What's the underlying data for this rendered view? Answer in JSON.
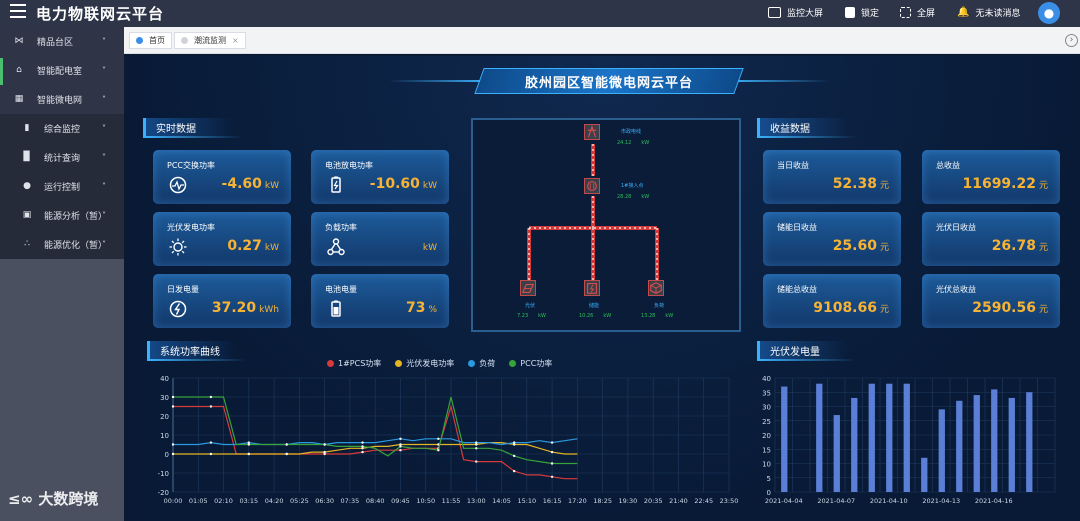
{
  "app": {
    "title": "电力物联网云平台",
    "menu_icon": "hamburger-icon"
  },
  "topbar": {
    "items": [
      {
        "label": "监控大屏",
        "icon": "monitor-icon"
      },
      {
        "label": "锁定",
        "icon": "lock-icon"
      },
      {
        "label": "全屏",
        "icon": "fullscreen-icon"
      },
      {
        "label": "无未读消息",
        "icon": "bell-icon"
      }
    ],
    "avatar_icon": "user-icon"
  },
  "sidebar": {
    "items": [
      {
        "label": "精品台区",
        "icon": "link-icon",
        "chevron": "˅"
      },
      {
        "label": "智能配电室",
        "icon": "home-icon",
        "chevron": "˅"
      },
      {
        "label": "智能微电网",
        "icon": "grid-icon",
        "chevron": "˄"
      }
    ],
    "sub_items": [
      {
        "label": "综合监控",
        "icon": "book-icon",
        "chevron": "˅"
      },
      {
        "label": "统计查询",
        "icon": "bar-icon",
        "chevron": "˅"
      },
      {
        "label": "运行控制",
        "icon": "circle-icon",
        "chevron": "˅"
      },
      {
        "label": "能源分析（暂）",
        "icon": "calendar-icon",
        "chevron": "˅"
      },
      {
        "label": "能源优化（暂）",
        "icon": "share-icon",
        "chevron": "˅"
      }
    ]
  },
  "tabs": [
    {
      "label": "首页",
      "active": true
    },
    {
      "label": "潮流监测",
      "active": false,
      "close": "×"
    }
  ],
  "dashboard": {
    "title": "胶州园区智能微电网云平台",
    "realtime": {
      "header": "实时数据",
      "cards": [
        {
          "label": "PCC交换功率",
          "value": "-4.60",
          "unit": "kW",
          "icon": "gauge-icon"
        },
        {
          "label": "电池放电功率",
          "value": "-10.60",
          "unit": "kW",
          "icon": "battery-icon"
        },
        {
          "label": "光伏发电功率",
          "value": "0.27",
          "unit": "kW",
          "icon": "sun-icon"
        },
        {
          "label": "负载功率",
          "value": "",
          "unit": "kW",
          "icon": "network-icon"
        },
        {
          "label": "日发电量",
          "value": "37.20",
          "unit": "kWh",
          "icon": "lightning-icon"
        },
        {
          "label": "电池电量",
          "value": "73",
          "unit": "%",
          "icon": "battery-level-icon"
        }
      ]
    },
    "diagram": {
      "nodes": [
        {
          "label": "市政电线",
          "value": "24.12",
          "unit": "kW",
          "icon": "tower-icon"
        },
        {
          "label": "1#接入点",
          "value": "28.28",
          "unit": "kW",
          "icon": "meter-icon"
        },
        {
          "label": "光伏",
          "value": "7.23",
          "unit": "kW",
          "icon": "solar-panel-icon"
        },
        {
          "label": "储能",
          "value": "10.26",
          "unit": "kW",
          "icon": "storage-icon"
        },
        {
          "label": "负荷",
          "value": "13.28",
          "unit": "kW",
          "icon": "load-box-icon"
        }
      ]
    },
    "revenue": {
      "header": "收益数据",
      "cards": [
        {
          "label": "当日收益",
          "value": "52.38",
          "unit": "元"
        },
        {
          "label": "总收益",
          "value": "11699.22",
          "unit": "元"
        },
        {
          "label": "储能日收益",
          "value": "25.60",
          "unit": "元"
        },
        {
          "label": "光伏日收益",
          "value": "26.78",
          "unit": "元"
        },
        {
          "label": "储能总收益",
          "value": "9108.66",
          "unit": "元"
        },
        {
          "label": "光伏总收益",
          "value": "2590.56",
          "unit": "元"
        }
      ]
    },
    "power_curve_header": "系统功率曲线",
    "pv_header": "光伏发电量"
  },
  "watermark": "大数跨境",
  "colors": {
    "accent": "#3cb2ff",
    "value": "#f7b334",
    "series_pcs": "#d83a3a",
    "series_pv": "#e6b422",
    "series_load": "#2a9ae0",
    "series_pcc": "#37a43a",
    "bar": "#5b7fd6"
  },
  "chart_data": [
    {
      "type": "line",
      "x": [
        "00:00",
        "00:30",
        "01:05",
        "01:35",
        "02:10",
        "02:40",
        "03:15",
        "03:45",
        "04:20",
        "04:50",
        "05:25",
        "05:55",
        "06:30",
        "07:00",
        "07:35",
        "08:05",
        "08:40",
        "09:10",
        "09:45",
        "10:15",
        "10:50",
        "11:20",
        "11:55",
        "12:25",
        "13:00",
        "13:30",
        "14:05",
        "14:35",
        "15:10",
        "15:40",
        "16:15",
        "16:45",
        "17:20",
        "17:50",
        "18:25",
        "18:55",
        "19:30",
        "20:00",
        "20:35",
        "21:05",
        "21:40",
        "22:10",
        "22:45",
        "23:15",
        "23:50"
      ],
      "x_ticks": [
        "00:00",
        "01:05",
        "02:10",
        "03:15",
        "04:20",
        "05:25",
        "06:30",
        "07:35",
        "08:40",
        "09:45",
        "10:50",
        "11:55",
        "13:00",
        "14:05",
        "15:10",
        "16:15",
        "17:20",
        "18:25",
        "19:30",
        "20:35",
        "21:40",
        "22:45",
        "23:50"
      ],
      "ylim": [
        -20,
        40
      ],
      "y_ticks": [
        -20,
        -10,
        0,
        10,
        20,
        30,
        40
      ],
      "series": [
        {
          "name": "1#PCS功率",
          "values": [
            25,
            25,
            25,
            25,
            25,
            0,
            0,
            0,
            0,
            0,
            0,
            0,
            0,
            0,
            0,
            1,
            2,
            2,
            2,
            3,
            3,
            3,
            25,
            -3,
            -4,
            -4,
            -4,
            -9,
            -11,
            -11,
            -12,
            -13,
            -13,
            null,
            null,
            null,
            null,
            null,
            null,
            null,
            null,
            null,
            null,
            null,
            null
          ]
        },
        {
          "name": "光伏发电功率",
          "values": [
            0,
            0,
            0,
            0,
            0,
            0,
            0,
            0,
            0,
            0,
            0,
            1,
            1,
            2,
            3,
            3,
            4,
            4,
            5,
            5,
            5,
            5,
            5,
            5,
            5,
            6,
            6,
            5,
            5,
            3,
            1,
            0,
            0,
            null,
            null,
            null,
            null,
            null,
            null,
            null,
            null,
            null,
            null,
            null,
            null
          ]
        },
        {
          "name": "负荷",
          "values": [
            5,
            5,
            5,
            6,
            5,
            5,
            6,
            5,
            5,
            5,
            6,
            6,
            5,
            6,
            6,
            6,
            6,
            7,
            8,
            7,
            8,
            8,
            8,
            6,
            6,
            6,
            5,
            6,
            6,
            7,
            6,
            7,
            8,
            null,
            null,
            null,
            null,
            null,
            null,
            null,
            null,
            null,
            null,
            null,
            null
          ]
        },
        {
          "name": "PCC功率",
          "values": [
            30,
            30,
            30,
            30,
            30,
            5,
            5,
            5,
            5,
            5,
            5,
            5,
            5,
            4,
            4,
            4,
            3,
            -1,
            4,
            3,
            3,
            2,
            30,
            3,
            3,
            3,
            2,
            -1,
            -3,
            -4,
            -5,
            -5,
            -5,
            null,
            null,
            null,
            null,
            null,
            null,
            null,
            null,
            null,
            null,
            null,
            null
          ]
        }
      ]
    },
    {
      "type": "bar",
      "categories": [
        "2021-04-04",
        "2021-04-05",
        "2021-04-06",
        "2021-04-07",
        "2021-04-08",
        "2021-04-09",
        "2021-04-10",
        "2021-04-11",
        "2021-04-12",
        "2021-04-13",
        "2021-04-14",
        "2021-04-15",
        "2021-04-16",
        "2021-04-17",
        "2021-04-18",
        "2021-04-19"
      ],
      "tick_labels": [
        "2021-04-04",
        "2021-04-07",
        "2021-04-10",
        "2021-04-13",
        "2021-04-16"
      ],
      "values": [
        37,
        0,
        38,
        27,
        33,
        38,
        38,
        38,
        12,
        29,
        32,
        34,
        36,
        33,
        35,
        0
      ],
      "ylim": [
        0,
        40
      ],
      "y_ticks": [
        0,
        5,
        10,
        15,
        20,
        25,
        30,
        35,
        40
      ]
    }
  ]
}
